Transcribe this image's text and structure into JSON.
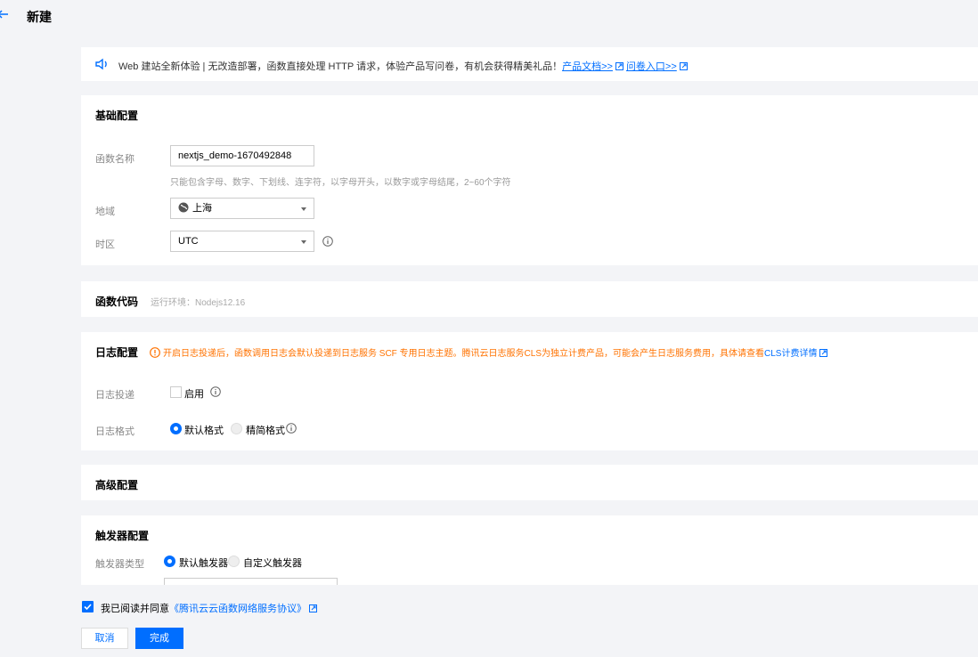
{
  "header": {
    "title": "新建"
  },
  "notice": {
    "text": "Web 建站全新体验 | 无改造部署，函数直接处理 HTTP 请求，体验产品写问卷，有机会获得精美礼品！",
    "link_docs": "产品文档>>",
    "link_survey": "问卷入口>>"
  },
  "basic": {
    "title": "基础配置",
    "name_label": "函数名称",
    "name_value": "nextjs_demo-1670492848",
    "name_hint": "只能包含字母、数字、下划线、连字符，以字母开头，以数字或字母结尾，2~60个字符",
    "region_label": "地域",
    "region_value": "上海",
    "timezone_label": "时区",
    "timezone_value": "UTC"
  },
  "code": {
    "title": "函数代码",
    "runtime": "运行环境：Nodejs12.16"
  },
  "log": {
    "title": "日志配置",
    "warning": "开启日志投递后，函数调用日志会默认投递到日志服务 SCF 专用日志主题。腾讯云日志服务CLS为独立计费产品，可能会产生日志服务费用，具体请查看",
    "warning_link": "CLS计费详情",
    "delivery_label": "日志投递",
    "delivery_option": "启用",
    "format_label": "日志格式",
    "format_default": "默认格式",
    "format_simple": "精简格式"
  },
  "advanced": {
    "title": "高级配置"
  },
  "trigger": {
    "title": "触发器配置",
    "type_label": "触发器类型",
    "type_default": "默认触发器",
    "type_custom": "自定义触发器"
  },
  "footer": {
    "agree_text": "我已阅读并同意",
    "agree_link": "《腾讯云云函数网络服务协议》",
    "cancel_label": "取消",
    "ok_label": "完成"
  },
  "colors": {
    "primary": "#006eff",
    "warning": "#ff7200",
    "background": "#f3f4f7"
  }
}
